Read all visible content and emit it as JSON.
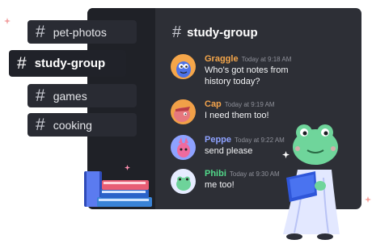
{
  "colors": {
    "panel_bg": "#2d2f36",
    "sidebar_bg": "#1f2127",
    "chip_bg": "#292b33",
    "active_chip_bg": "#202229",
    "graggle": "#f5a64a",
    "cap": "#f4a44c",
    "peppe": "#8ea2ff",
    "phibi": "#52d98a"
  },
  "channel_header": {
    "name": "study-group"
  },
  "channels": [
    {
      "name": "pet-photos"
    },
    {
      "name": "study-group"
    },
    {
      "name": "games"
    },
    {
      "name": "cooking"
    }
  ],
  "messages": [
    {
      "author": "Graggle",
      "time": "Today at 9:18 AM",
      "text_lines": [
        "Who's got notes from",
        "history today?"
      ],
      "avatar_icon": "graggle-avatar-icon"
    },
    {
      "author": "Cap",
      "time": "Today at 9:19 AM",
      "text_lines": [
        "I need them too!"
      ],
      "avatar_icon": "cap-avatar-icon"
    },
    {
      "author": "Peppe",
      "time": "Today at 9:22 AM",
      "text_lines": [
        "send please"
      ],
      "avatar_icon": "peppe-avatar-icon"
    },
    {
      "author": "Phibi",
      "time": "Today at 9:30 AM",
      "text_lines": [
        "me too!"
      ],
      "avatar_icon": "phibi-avatar-icon"
    }
  ],
  "decorations": [
    "sparkle-icon",
    "book-stack-illustration",
    "frog-reading-illustration"
  ]
}
